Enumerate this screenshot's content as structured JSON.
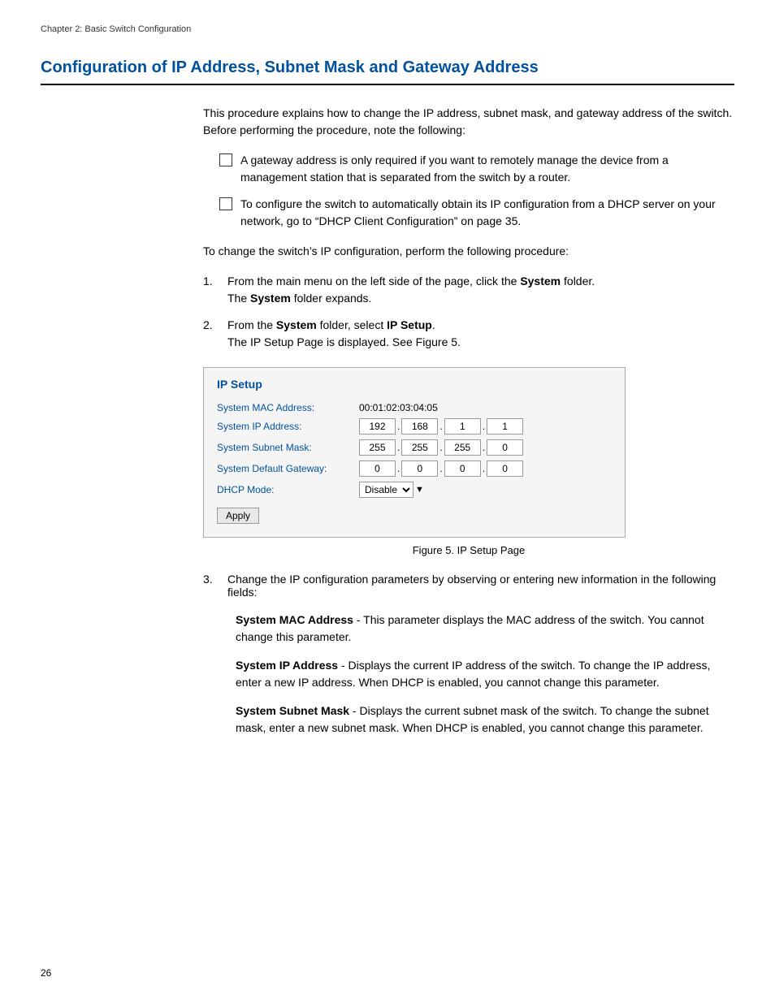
{
  "chapter_header": "Chapter 2: Basic Switch Configuration",
  "section_title": "Configuration of IP Address, Subnet Mask and Gateway Address",
  "intro_paragraph": "This procedure explains how to change the IP address, subnet mask, and gateway address of the switch. Before performing the procedure, note the following:",
  "bullets": [
    "A gateway address is only required if you want to remotely manage the device from a management station that is separated from the switch by a router.",
    "To configure the switch to automatically obtain its IP configuration from a DHCP server on your network, go to “DHCP Client Configuration” on page 35."
  ],
  "procedure_intro": "To change the switch’s IP configuration, perform the following procedure:",
  "steps": [
    {
      "num": "1.",
      "text_parts": [
        {
          "text": "From the main menu on the left side of the page, click the ",
          "bold": false
        },
        {
          "text": "System",
          "bold": true
        },
        {
          "text": " folder.",
          "bold": false
        }
      ],
      "sub_text": [
        "The ",
        "System",
        " folder expands."
      ]
    },
    {
      "num": "2.",
      "text_parts": [
        {
          "text": "From the ",
          "bold": false
        },
        {
          "text": "System",
          "bold": true
        },
        {
          "text": " folder, select ",
          "bold": false
        },
        {
          "text": "IP Setup",
          "bold": true
        },
        {
          "text": ".",
          "bold": false
        }
      ],
      "sub_text": [
        "The IP Setup Page is displayed. See Figure 5."
      ]
    }
  ],
  "ip_setup": {
    "title": "IP Setup",
    "fields": [
      {
        "label": "System MAC Address:",
        "type": "text",
        "value": "00:01:02:03:04:05"
      },
      {
        "label": "System IP Address:",
        "type": "ip",
        "octets": [
          "192",
          "168",
          "1",
          "1"
        ]
      },
      {
        "label": "System Subnet Mask:",
        "type": "ip",
        "octets": [
          "255",
          "255",
          "255",
          "0"
        ]
      },
      {
        "label": "System Default Gateway:",
        "type": "ip",
        "octets": [
          "0",
          "0",
          "0",
          "0"
        ]
      },
      {
        "label": "DHCP Mode:",
        "type": "select",
        "options": [
          "Disable"
        ]
      }
    ],
    "apply_label": "Apply"
  },
  "figure_caption": "Figure 5. IP Setup Page",
  "step3_intro": "Change the IP configuration parameters by observing or entering new information in the following fields:",
  "field_descriptions": [
    {
      "label": "System MAC Address",
      "desc": " - This parameter displays the MAC address of the switch. You cannot change this parameter."
    },
    {
      "label": "System IP Address",
      "desc": " - Displays the current IP address of the switch. To change the IP address, enter a new IP address. When DHCP is enabled, you cannot change this parameter."
    },
    {
      "label": "System Subnet Mask",
      "desc": " - Displays the current subnet mask of the switch. To change the subnet mask, enter a new subnet mask. When DHCP is enabled, you cannot change this parameter."
    }
  ],
  "page_number": "26"
}
